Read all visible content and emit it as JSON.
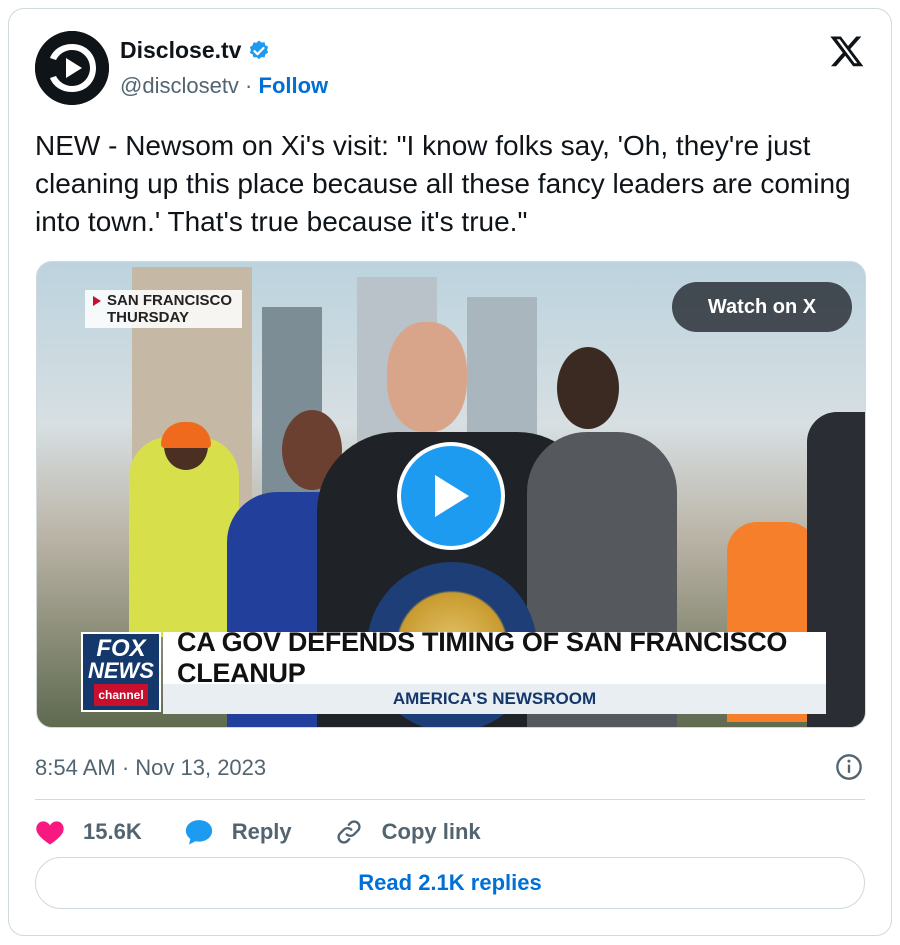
{
  "author": {
    "display_name": "Disclose.tv",
    "handle": "@disclosetv",
    "separator": " · ",
    "follow_label": "Follow",
    "verified": true
  },
  "tweet": {
    "text": "NEW - Newsom on Xi's visit: \"I know folks say, 'Oh, they're just cleaning up this place because all these fancy leaders are coming into town.' That's true because it's true.\""
  },
  "media": {
    "location_line1": "SAN FRANCISCO",
    "location_line2": "THURSDAY",
    "watch_label": "Watch on X",
    "chyron_headline": "CA GOV DEFENDS TIMING OF SAN FRANCISCO CLEANUP",
    "chyron_subtitle": "AMERICA'S NEWSROOM",
    "network_logo_line1": "FOX",
    "network_logo_line2": "NEWS",
    "network_logo_line3": "channel"
  },
  "meta": {
    "timestamp": "8:54 AM · Nov 13, 2023"
  },
  "actions": {
    "like_count": "15.6K",
    "reply_label": "Reply",
    "copy_link_label": "Copy link"
  },
  "read_replies_label": "Read 2.1K replies",
  "colors": {
    "accent": "#1d9bf0",
    "link": "#006fd6",
    "like": "#f91880",
    "text_secondary": "#536471"
  }
}
